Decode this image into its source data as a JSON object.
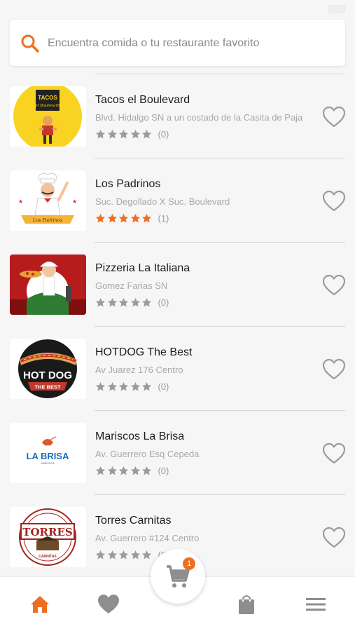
{
  "theme": {
    "accent": "#ee6f1f",
    "star_inactive": "#9b9b9b",
    "heart_outline": "#9b9b9b",
    "nav_icon": "#8e8e8e"
  },
  "search": {
    "placeholder": "Encuentra comida o tu restaurante favorito",
    "icon": "search-icon"
  },
  "restaurants": [
    {
      "name": "Tacos el Boulevard",
      "address": "Blvd. Hidalgo SN a un costado de la Casita de Paja",
      "rating": 0,
      "rating_count": "(0)",
      "favorite": false,
      "logo_text": "TACOS",
      "logo_subtext": "el Boulevard"
    },
    {
      "name": "Los Padrinos",
      "address": "Suc. Degollado X Suc. Boulevard",
      "rating": 5,
      "rating_count": "(1)",
      "favorite": false,
      "logo_text": "Los Padrinos"
    },
    {
      "name": "Pizzeria La Italiana",
      "address": "Gomez Farias SN",
      "rating": 0,
      "rating_count": "(0)",
      "favorite": false
    },
    {
      "name": "HOTDOG The Best",
      "address": "Av Juarez 176 Centro",
      "rating": 0,
      "rating_count": "(0)",
      "favorite": false,
      "logo_text": "HOT DOG",
      "logo_subtext": "THE BEST"
    },
    {
      "name": "Mariscos La Brisa",
      "address": "Av. Guerrero Esq Cepeda",
      "rating": 0,
      "rating_count": "(0)",
      "favorite": false,
      "logo_text": "LA BRISA",
      "logo_subtext": "MARISCOS"
    },
    {
      "name": "Torres Carnitas",
      "address": "Av. Guerrero #124 Centro",
      "rating": 0,
      "rating_count": "(0)",
      "favorite": false,
      "logo_text": "TORRES",
      "logo_subtext": "CARNITAS"
    }
  ],
  "bottom_nav": {
    "items": [
      {
        "icon": "home-icon",
        "active": true
      },
      {
        "icon": "heart-icon",
        "active": false
      },
      {
        "icon": "shopping-bag-icon",
        "active": false
      },
      {
        "icon": "menu-icon",
        "active": false
      }
    ],
    "cart": {
      "icon": "cart-icon",
      "badge": "1"
    }
  }
}
